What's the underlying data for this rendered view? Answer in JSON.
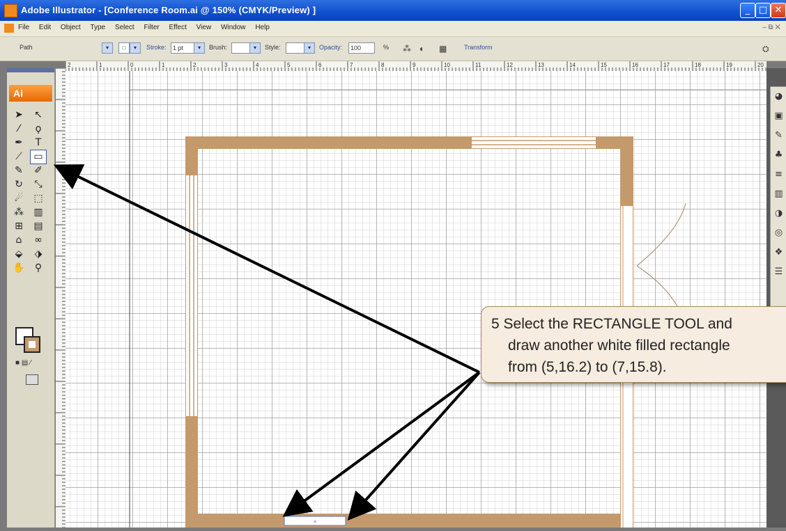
{
  "window": {
    "title": "Adobe Illustrator - [Conference Room.ai @ 150% (CMYK/Preview) ]",
    "minimize_icon": "minimize-icon",
    "maximize_icon": "maximize-icon",
    "close_icon": "close-icon"
  },
  "menu": {
    "items": [
      "File",
      "Edit",
      "Object",
      "Type",
      "Select",
      "Filter",
      "Effect",
      "View",
      "Window",
      "Help"
    ]
  },
  "control_bar": {
    "selection_label": "Path",
    "stroke_label": "Stroke:",
    "stroke_value": "1 pt",
    "brush_label": "Brush:",
    "style_label": "Style:",
    "opacity_label": "Opacity:",
    "opacity_value": "100",
    "opacity_unit": "%",
    "transform_label": "Transform"
  },
  "toolbox": {
    "logo": "Ai",
    "tools": [
      "selection-tool",
      "direct-selection-tool",
      "magic-wand-tool",
      "lasso-tool",
      "pen-tool",
      "type-tool",
      "line-tool",
      "rectangle-tool",
      "paintbrush-tool",
      "pencil-tool",
      "rotate-tool",
      "scale-tool",
      "warp-tool",
      "free-transform-tool",
      "symbol-sprayer-tool",
      "graph-tool",
      "mesh-tool",
      "gradient-tool",
      "eyedropper-tool",
      "blend-tool",
      "live-paint-tool",
      "live-paint-selection-tool",
      "hand-tool",
      "zoom-tool"
    ],
    "active_tool": "rectangle-tool",
    "fill_color": "#ffffff",
    "stroke_color": "#c49a6c"
  },
  "ruler": {
    "ticks": [
      "2",
      "1",
      "0",
      "1",
      "2",
      "3",
      "4",
      "5",
      "6",
      "7",
      "8",
      "9",
      "10",
      "11",
      "12",
      "13",
      "14",
      "15",
      "16",
      "17",
      "18",
      "19",
      "20"
    ]
  },
  "instruction": {
    "line1": "5  Select the RECTANGLE TOOL and",
    "line2": "draw another white filled rectangle",
    "line3": "from (5,16.2) to (7,15.8)."
  },
  "colors": {
    "wall": "#c49a6c",
    "callout_bg": "#f6ecdf",
    "arrow": "#000000"
  }
}
